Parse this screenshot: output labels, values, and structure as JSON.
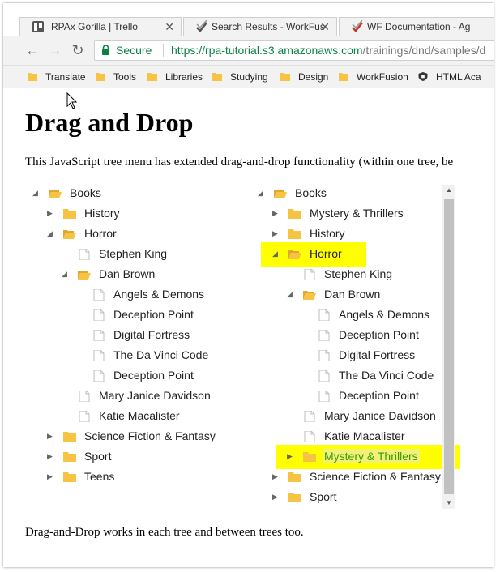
{
  "tabs": [
    {
      "title": "RPAx Gorilla | Trello",
      "close": "✕",
      "icon": "trello-icon"
    },
    {
      "title": "Search Results - WorkFus",
      "close": "✕",
      "icon": "workfusion-icon"
    },
    {
      "title": "WF Documentation - Ag",
      "close": "",
      "icon": "workfusion-icon"
    }
  ],
  "address": {
    "secure_label": "Secure",
    "url_host": "https://rpa-tutorial.s3.amazonaws.com",
    "url_path": "/trainings/dnd/samples/d"
  },
  "bookmarks": [
    {
      "label": "Translate",
      "icon": "folder-icon"
    },
    {
      "label": "Tools",
      "icon": "folder-icon"
    },
    {
      "label": "Libraries",
      "icon": "folder-icon"
    },
    {
      "label": "Studying",
      "icon": "folder-icon"
    },
    {
      "label": "Design",
      "icon": "folder-icon"
    },
    {
      "label": "WorkFusion",
      "icon": "folder-icon"
    },
    {
      "label": "HTML Aca",
      "icon": "shield-icon"
    }
  ],
  "page": {
    "heading": "Drag and Drop",
    "intro": "This JavaScript tree menu has extended drag-and-drop functionality (within one tree, be",
    "footer": "Drag-and-Drop works in each tree and between trees too."
  },
  "colors": {
    "highlight": "#ffff00",
    "folder": "#f6c342",
    "secure_green": "#0b8043",
    "moved_text": "#3d9b00"
  },
  "tree_left": [
    {
      "label": "Books",
      "type": "folder",
      "level": 0,
      "toggle": "open"
    },
    {
      "label": "History",
      "type": "folder",
      "level": 1,
      "toggle": "closed"
    },
    {
      "label": "Horror",
      "type": "folder",
      "level": 1,
      "toggle": "open"
    },
    {
      "label": "Stephen King",
      "type": "file",
      "level": 2,
      "toggle": "none"
    },
    {
      "label": "Dan Brown",
      "type": "folder",
      "level": 2,
      "toggle": "open"
    },
    {
      "label": "Angels & Demons",
      "type": "file",
      "level": 3,
      "toggle": "none"
    },
    {
      "label": "Deception Point",
      "type": "file",
      "level": 3,
      "toggle": "none"
    },
    {
      "label": "Digital Fortress",
      "type": "file",
      "level": 3,
      "toggle": "none"
    },
    {
      "label": "The Da Vinci Code",
      "type": "file",
      "level": 3,
      "toggle": "none"
    },
    {
      "label": "Deception Point",
      "type": "file",
      "level": 3,
      "toggle": "none"
    },
    {
      "label": "Mary Janice Davidson",
      "type": "file",
      "level": 2,
      "toggle": "none"
    },
    {
      "label": "Katie Macalister",
      "type": "file",
      "level": 2,
      "toggle": "none"
    },
    {
      "label": "Science Fiction & Fantasy",
      "type": "folder",
      "level": 1,
      "toggle": "closed"
    },
    {
      "label": "Sport",
      "type": "folder",
      "level": 1,
      "toggle": "closed"
    },
    {
      "label": "Teens",
      "type": "folder",
      "level": 1,
      "toggle": "closed"
    }
  ],
  "tree_right": [
    {
      "label": "Books",
      "type": "folder",
      "level": 0,
      "toggle": "open"
    },
    {
      "label": "Mystery & Thrillers",
      "type": "folder",
      "level": 1,
      "toggle": "closed"
    },
    {
      "label": "History",
      "type": "folder",
      "level": 1,
      "toggle": "closed"
    },
    {
      "label": "Horror",
      "type": "folder",
      "level": 1,
      "toggle": "open",
      "highlight": true
    },
    {
      "label": "Stephen King",
      "type": "file",
      "level": 2,
      "toggle": "none"
    },
    {
      "label": "Dan Brown",
      "type": "folder",
      "level": 2,
      "toggle": "open"
    },
    {
      "label": "Angels & Demons",
      "type": "file",
      "level": 3,
      "toggle": "none"
    },
    {
      "label": "Deception Point",
      "type": "file",
      "level": 3,
      "toggle": "none"
    },
    {
      "label": "Digital Fortress",
      "type": "file",
      "level": 3,
      "toggle": "none"
    },
    {
      "label": "The Da Vinci Code",
      "type": "file",
      "level": 3,
      "toggle": "none"
    },
    {
      "label": "Deception Point",
      "type": "file",
      "level": 3,
      "toggle": "none"
    },
    {
      "label": "Mary Janice Davidson",
      "type": "file",
      "level": 2,
      "toggle": "none"
    },
    {
      "label": "Katie Macalister",
      "type": "file",
      "level": 2,
      "toggle": "none"
    },
    {
      "label": "Mystery & Thrillers",
      "type": "folder",
      "level": 2,
      "toggle": "closed",
      "highlight": true,
      "moved": true
    },
    {
      "label": "Science Fiction & Fantasy",
      "type": "folder",
      "level": 1,
      "toggle": "closed"
    },
    {
      "label": "Sport",
      "type": "folder",
      "level": 1,
      "toggle": "closed"
    }
  ]
}
